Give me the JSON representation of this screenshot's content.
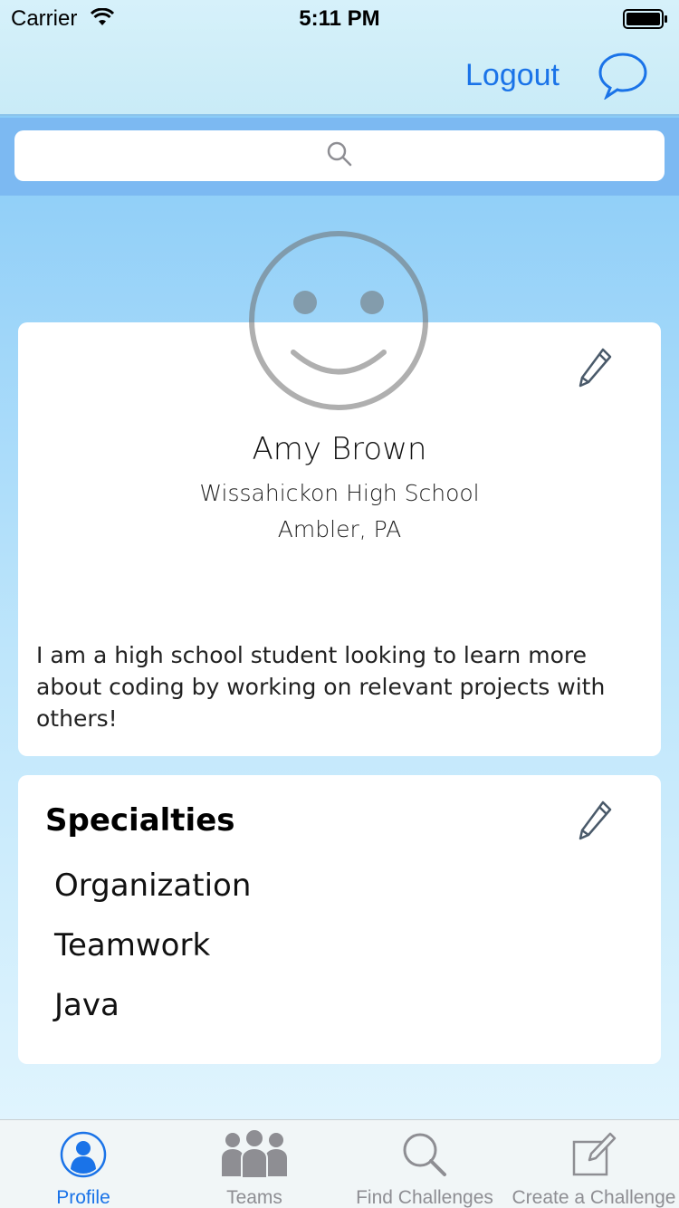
{
  "status": {
    "carrier": "Carrier",
    "time": "5:11 PM"
  },
  "nav": {
    "logout_label": "Logout",
    "chat_icon": "chat-bubble-icon"
  },
  "search": {
    "icon": "search-icon",
    "placeholder": ""
  },
  "profile": {
    "avatar_icon": "smiley-face-icon",
    "name": "Amy Brown",
    "school": "Wissahickon High School",
    "location": "Ambler, PA",
    "bio": "I am a high school student looking to learn more about coding by working on relevant projects with others!",
    "edit_icon": "pencil-icon"
  },
  "specialties": {
    "title": "Specialties",
    "items": [
      "Organization",
      "Teamwork",
      "Java"
    ],
    "edit_icon": "pencil-icon"
  },
  "tabs": [
    {
      "label": "Profile",
      "icon": "person-icon",
      "active": true
    },
    {
      "label": "Teams",
      "icon": "group-icon",
      "active": false
    },
    {
      "label": "Find Challenges",
      "icon": "magnifier-icon",
      "active": false
    },
    {
      "label": "Create a Challenge",
      "icon": "compose-icon",
      "active": false
    }
  ],
  "colors": {
    "accent": "#1a73e8",
    "inactive_tab": "#8e8e93",
    "search_band": "#7cb9f2"
  }
}
